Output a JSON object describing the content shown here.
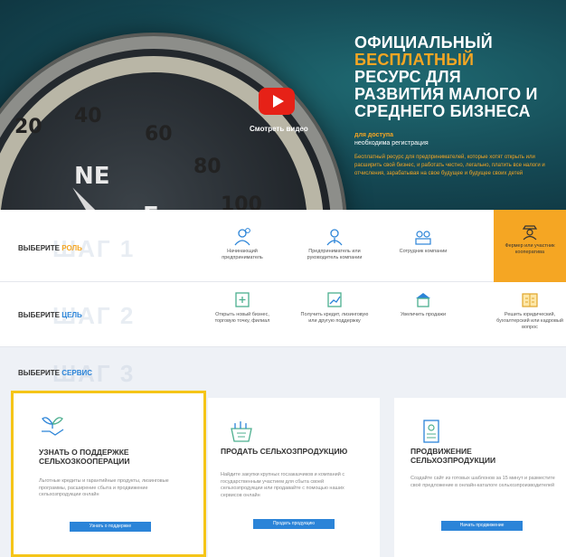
{
  "hero": {
    "video_label": "Смотреть видео",
    "title_line1": "ОФИЦИАЛЬНЫЙ",
    "title_accent": "БЕСПЛАТНЫЙ",
    "title_line3": "РЕСУРС ДЛЯ",
    "title_line4": "РАЗВИТИЯ МАЛОГО И",
    "title_line5": "СРЕДНЕГО БИЗНЕСА",
    "access": "для доступа",
    "access_sub": "необходима регистрация",
    "description": "Бесплатный ресурс для предпринимателей, которые хотят открыть или расширить свой бизнес, и работать честно, легально, платить все налоги и отчисления, зарабатывая на свое будущее и будущее своих детей",
    "compass_numbers": [
      "20",
      "40",
      "60",
      "80",
      "100"
    ],
    "compass_dirs": [
      "NE",
      "E"
    ]
  },
  "step1": {
    "caption_prefix": "ВЫБЕРИТЕ",
    "caption_word": "РОЛЬ",
    "big": "ШАГ 1",
    "options": [
      {
        "label": "Начинающий предприниматель"
      },
      {
        "label": "Предприниматель или руководитель компании"
      },
      {
        "label": "Сотрудник компании"
      },
      {
        "label": "Фермер или участник кооператива"
      }
    ]
  },
  "step2": {
    "caption_prefix": "ВЫБЕРИТЕ",
    "caption_word": "ЦЕЛЬ",
    "big": "ШАГ 2",
    "options": [
      {
        "label": "Открыть новый бизнес, торговую точку, филиал"
      },
      {
        "label": "Получить кредит, лизинговую или другую поддержку"
      },
      {
        "label": "Увеличить продажи"
      },
      {
        "label": "Решить юридический, бухгалтерский или кадровый вопрос"
      }
    ]
  },
  "step3": {
    "caption_prefix": "ВЫБЕРИТЕ",
    "caption_word": "СЕРВИС",
    "big": "ШАГ 3"
  },
  "cards": [
    {
      "title": "УЗНАТЬ О ПОДДЕРЖКЕ СЕЛЬХОЗКООПЕРАЦИИ",
      "desc": "Льготные кредиты и гарантийные продукты, лизинговые программы, расширение сбыта и продвижение сельхозпродукции онлайн",
      "button": "Узнать о поддержке"
    },
    {
      "title": "ПРОДАТЬ СЕЛЬХОЗПРОДУКЦИЮ",
      "desc": "Найдите закупки крупных госзаказчиков и компаний с государственным участием для сбыта своей сельхозпродукции или продавайте с помощью наших сервисов онлайн",
      "button": "Продать продукцию"
    },
    {
      "title": "ПРОДВИЖЕНИЕ СЕЛЬХОЗПРОДУКЦИИ",
      "desc": "Создайте сайт из готовых шаблонов за 15 минут и разместите своё предложение в онлайн-каталоге сельхозпроизводителей",
      "button": "Начать продвижение"
    }
  ],
  "colors": {
    "accent": "#f5a623",
    "blue": "#2b84d8",
    "selected_border": "#f5c518",
    "hero_bg": "#164c57"
  }
}
